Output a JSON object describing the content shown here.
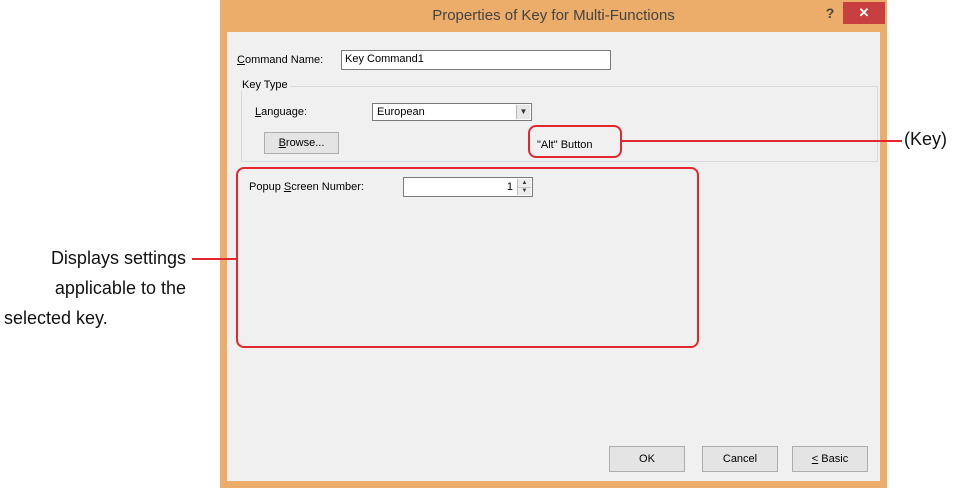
{
  "dialog": {
    "title": "Properties of Key for Multi-Functions",
    "help_label": "?",
    "close_label": "✕",
    "command_name": {
      "label_prefix": "",
      "label_hotkey": "C",
      "label_rest": "ommand Name:",
      "value": "Key Command1"
    },
    "key_type": {
      "group_title": "Key Type",
      "language_hotkey": "L",
      "language_rest": "anguage:",
      "language_value": "European",
      "browse_hotkey": "B",
      "browse_rest": "rowse...",
      "key_name": "\"Alt\" Button"
    },
    "popup": {
      "label_prefix": "Popup ",
      "label_hotkey": "S",
      "label_rest": "creen Number:",
      "value": "1"
    },
    "buttons": {
      "ok": "OK",
      "cancel": "Cancel",
      "basic_hotkey": "<",
      "basic_rest": " Basic"
    }
  },
  "annotations": {
    "key_callout": "(Key)",
    "settings_callout_line1": "Displays settings",
    "settings_callout_line2": "applicable to the",
    "settings_callout_line3": "selected key."
  },
  "colors": {
    "frame": "#ecad6a",
    "close": "#c7403f",
    "highlight": "#e4262e"
  }
}
